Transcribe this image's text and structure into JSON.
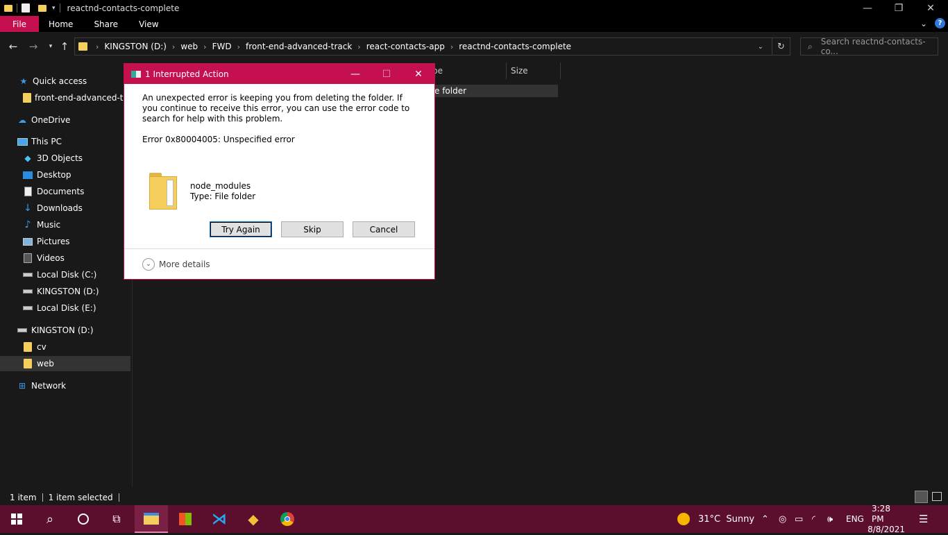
{
  "window": {
    "title": "reactnd-contacts-complete",
    "controls": {
      "minimize": "—",
      "restore": "❐",
      "close": "✕"
    }
  },
  "ribbon": {
    "tabs": [
      "File",
      "Home",
      "Share",
      "View"
    ]
  },
  "address": {
    "crumbs": [
      "KINGSTON (D:)",
      "web",
      "FWD",
      "front-end-advanced-track",
      "react-contacts-app",
      "reactnd-contacts-complete"
    ]
  },
  "search": {
    "placeholder": "Search reactnd-contacts-co..."
  },
  "nav": {
    "items": [
      {
        "label": "Quick access",
        "icon": "star-icon"
      },
      {
        "label": "front-end-advanced-track",
        "icon": "folder-icon"
      },
      {
        "label": "OneDrive",
        "icon": "cloud-icon"
      },
      {
        "label": "This PC",
        "icon": "computer-icon"
      },
      {
        "label": "3D Objects",
        "icon": "cube-icon"
      },
      {
        "label": "Desktop",
        "icon": "desktop-icon"
      },
      {
        "label": "Documents",
        "icon": "document-icon"
      },
      {
        "label": "Downloads",
        "icon": "download-icon"
      },
      {
        "label": "Music",
        "icon": "music-icon"
      },
      {
        "label": "Pictures",
        "icon": "pictures-icon"
      },
      {
        "label": "Videos",
        "icon": "video-icon"
      },
      {
        "label": "Local Disk (C:)",
        "icon": "drive-icon"
      },
      {
        "label": "KINGSTON (D:)",
        "icon": "drive-icon"
      },
      {
        "label": "Local Disk (E:)",
        "icon": "drive-icon"
      },
      {
        "label": "KINGSTON (D:)",
        "icon": "drive-icon"
      },
      {
        "label": "cv",
        "icon": "folder-icon"
      },
      {
        "label": "web",
        "icon": "folder-icon"
      },
      {
        "label": "Network",
        "icon": "network-icon"
      }
    ]
  },
  "content": {
    "columns": [
      "pe",
      "Size"
    ],
    "selected_row_type": "e folder"
  },
  "status": {
    "count": "1 item",
    "selected": "1 item selected"
  },
  "dialog": {
    "title": "1 Interrupted Action",
    "message": "An unexpected error is keeping you from deleting the folder. If you continue to receive this error, you can use the error code to search for help with this problem.",
    "error": "Error 0x80004005: Unspecified error",
    "file_name": "node_modules",
    "file_type": "Type: File folder",
    "buttons": {
      "try_again": "Try Again",
      "skip": "Skip",
      "cancel": "Cancel"
    },
    "more_details": "More details"
  },
  "taskbar": {
    "weather": "31°C  Sunny",
    "lang": "ENG",
    "time": "3:28 PM",
    "date": "8/8/2021"
  },
  "colors": {
    "accent": "#c4104f",
    "taskbar": "#5c0f2d",
    "background": "#191919"
  }
}
